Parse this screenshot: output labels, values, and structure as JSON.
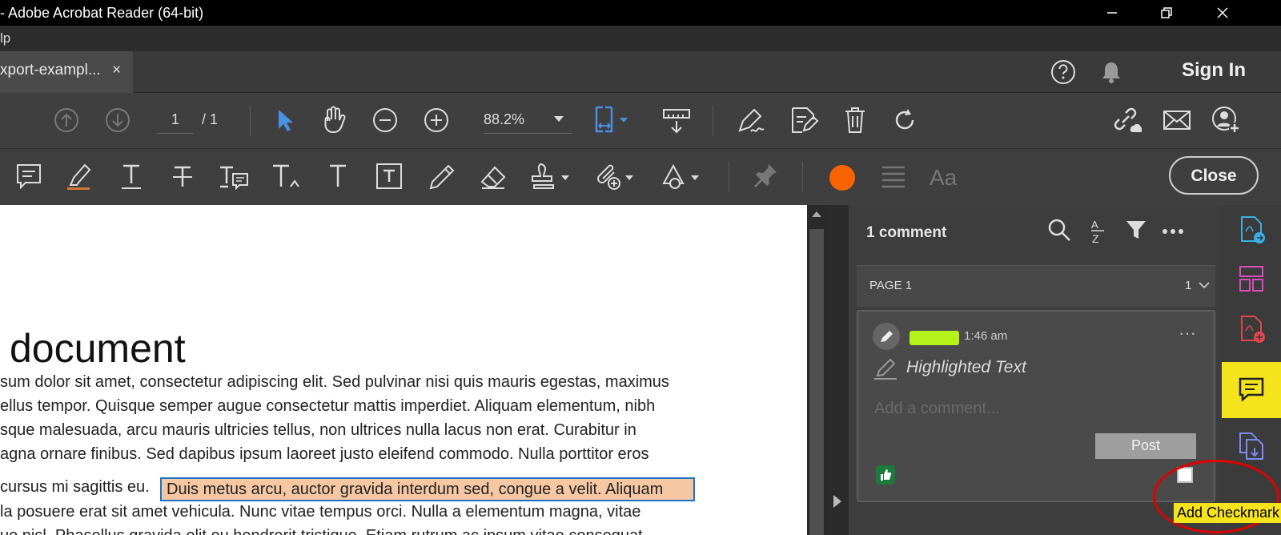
{
  "titlebar": {
    "title": "- Adobe Acrobat Reader (64-bit)"
  },
  "menubar": {
    "visible_item": "lp"
  },
  "tab": {
    "label": "xport-exampl...",
    "close": "×"
  },
  "header": {
    "sign_in": "Sign In"
  },
  "toolbar": {
    "page_current": "1",
    "page_total": "/  1",
    "zoom": "88.2%",
    "close_label": "Close"
  },
  "document": {
    "heading": "document",
    "lines": [
      "sum dolor sit amet, consectetur adipiscing elit. Sed pulvinar nisi quis mauris egestas, maximus",
      "ellus tempor. Quisque semper augue consectetur mattis imperdiet. Aliquam elementum, nibh",
      "sque malesuada, arcu mauris ultricies tellus, non ultrices nulla lacus non erat. Curabitur in",
      "agna ornare finibus. Sed dapibus ipsum laoreet justo eleifend commodo. Nulla porttitor eros",
      " cursus mi sagittis eu.",
      "la posuere erat sit amet vehicula. Nunc vitae tempus orci. Nulla a elementum magna, vitae",
      "ue nisl. Phasellus gravida elit eu hendrerit tristique. Etiam rutrum ac ipsum vitae consequat."
    ],
    "highlighted": "Duis metus arcu, auctor gravida interdum sed, congue a velit. Aliquam"
  },
  "comments": {
    "header": "1 comment",
    "page_label": "PAGE 1",
    "page_count": "1",
    "card": {
      "time": "1:46 am",
      "type": "Highlighted Text",
      "placeholder": "Add a comment...",
      "post": "Post"
    }
  },
  "tooltip": {
    "text": "Add Checkmark"
  },
  "colors": {
    "accent_blue": "#4a90e2",
    "orange": "#fa6400",
    "yellow": "#f5e31c",
    "annotation_red": "#e00000",
    "highlight": "#f6c7a3"
  }
}
